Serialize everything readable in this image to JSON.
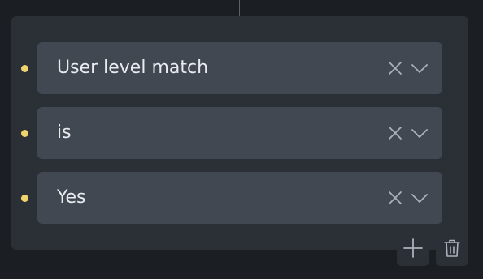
{
  "condition": {
    "field": {
      "value": "User level match",
      "clear_icon": "close-icon",
      "expand_icon": "chevron-down-icon"
    },
    "operator": {
      "value": "is",
      "clear_icon": "close-icon",
      "expand_icon": "chevron-down-icon"
    },
    "comparison_value": {
      "value": "Yes",
      "clear_icon": "close-icon",
      "expand_icon": "chevron-down-icon"
    }
  },
  "actions": {
    "add_icon": "plus-icon",
    "delete_icon": "trash-icon"
  },
  "colors": {
    "background": "#1b1e22",
    "panel": "#2b3037",
    "select": "#414852",
    "text": "#e9ecef",
    "icon": "#aab1ba",
    "indicator": "#f1d36d"
  }
}
